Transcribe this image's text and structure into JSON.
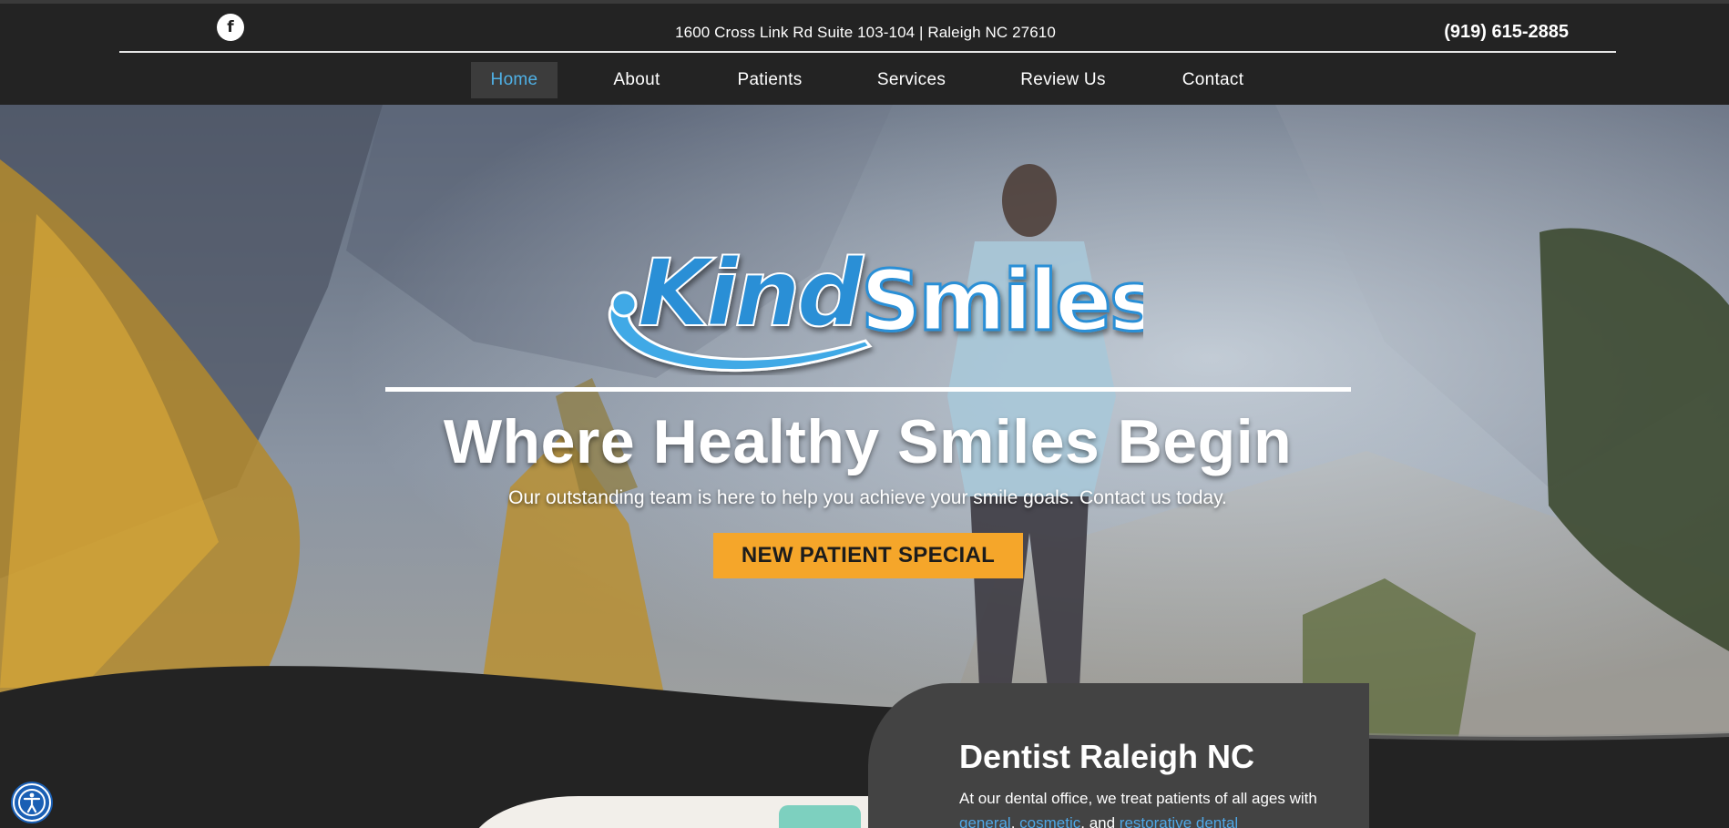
{
  "header": {
    "social_icon": "facebook-icon",
    "social_glyph": "f",
    "address": "1600 Cross Link Rd Suite 103-104 | Raleigh NC 27610",
    "phone": "(919) 615-2885"
  },
  "nav": {
    "items": [
      {
        "label": "Home",
        "active": true
      },
      {
        "label": "About"
      },
      {
        "label": "Patients"
      },
      {
        "label": "Services"
      },
      {
        "label": "Review Us"
      },
      {
        "label": "Contact"
      }
    ]
  },
  "hero": {
    "logo": {
      "part1": "Kind",
      "part2": "Smiles"
    },
    "headline": "Where Healthy Smiles Begin",
    "subline": "Our outstanding team is here to help you achieve your smile goals. Contact us today.",
    "cta_label": "NEW PATIENT SPECIAL"
  },
  "intro": {
    "title": "Dentist Raleigh NC",
    "text_start": "At our dental office, we treat patients of all ages with ",
    "link1": "general",
    "sep1": ", ",
    "link2": "cosmetic",
    "sep2": ", and ",
    "link3": "restorative dental"
  },
  "accessibility": {
    "icon": "accessibility-icon"
  },
  "colors": {
    "background": "#232323",
    "accent_blue": "#4fb1e6",
    "cta": "#f5a62a",
    "card": "#434343"
  }
}
